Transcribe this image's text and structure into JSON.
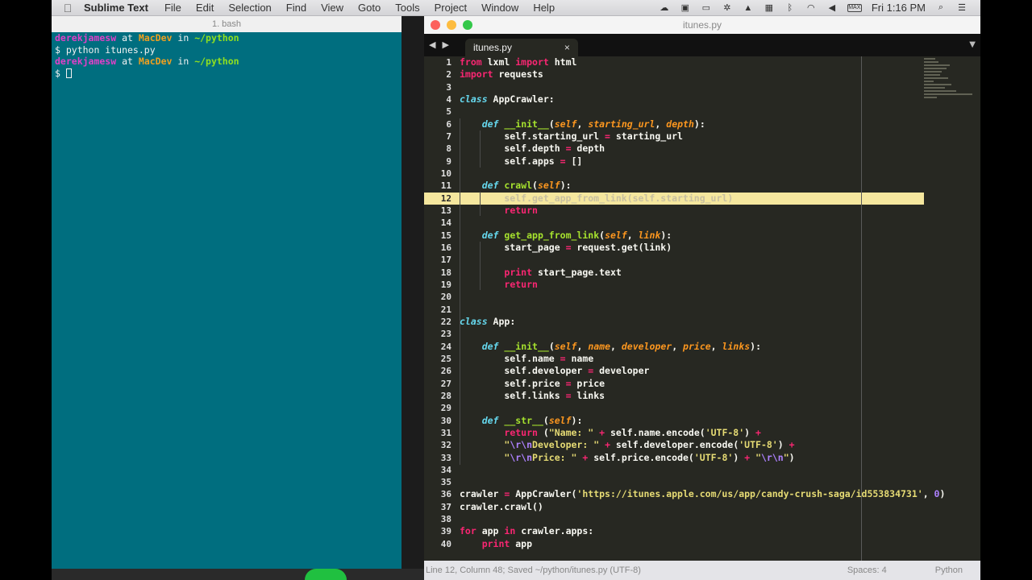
{
  "menubar": {
    "app_name": "Sublime Text",
    "menus": [
      "File",
      "Edit",
      "Selection",
      "Find",
      "View",
      "Goto",
      "Tools",
      "Project",
      "Window",
      "Help"
    ],
    "clock": "Fri 1:16 PM",
    "battery_label": "MAX"
  },
  "terminal": {
    "title": "1. bash",
    "user": "derekjamesw",
    "at": "at",
    "host": "MacDev",
    "in": "in",
    "path": "~/python",
    "command": "$ python itunes.py",
    "prompt": "$ "
  },
  "window": {
    "title": "itunes.py"
  },
  "tabs": [
    {
      "label": "itunes.py",
      "close": "×"
    }
  ],
  "editor": {
    "line_numbers": [
      "1",
      "2",
      "3",
      "4",
      "5",
      "6",
      "7",
      "8",
      "9",
      "10",
      "11",
      "12",
      "13",
      "14",
      "15",
      "16",
      "17",
      "18",
      "19",
      "20",
      "21",
      "22",
      "23",
      "24",
      "25",
      "26",
      "27",
      "28",
      "29",
      "30",
      "31",
      "32",
      "33",
      "34",
      "35",
      "36",
      "37",
      "38",
      "39",
      "40"
    ],
    "highlighted_line": 12,
    "language": "Python"
  },
  "statusbar": {
    "position": "Line 12, Column 48; Saved ~/python/itunes.py (UTF-8)",
    "spaces": "Spaces: 4",
    "syntax": "Python"
  },
  "colors": {
    "terminal_bg": "#006e7f",
    "editor_bg": "#272822",
    "highlight": "#f5e79e"
  }
}
